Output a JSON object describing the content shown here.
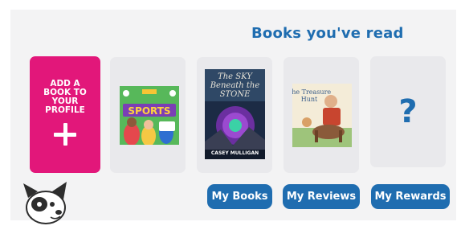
{
  "section": {
    "heading": "Books you've read"
  },
  "add_card": {
    "label": "ADD A\nBOOK TO\nYOUR\nPROFILE",
    "icon": "plus-icon"
  },
  "books": [
    {
      "title": "SPORTS",
      "cover_color": "#57b85a"
    },
    {
      "title": "The SKY Beneath the STONE",
      "author": "CASEY MULLIGAN",
      "cover_color": "#21314a"
    },
    {
      "title": "The Treasure Hunt",
      "cover_color": "#f4ecd8"
    }
  ],
  "placeholder": {
    "symbol": "?"
  },
  "buttons": {
    "my_books": "My Books",
    "my_reviews": "My Reviews",
    "my_rewards": "My Rewards"
  },
  "colors": {
    "accent_blue": "#1f6db0",
    "add_pink": "#e2177a",
    "panel_bg": "#f3f3f4"
  },
  "mascot": {
    "icon": "dog-mascot-icon"
  }
}
